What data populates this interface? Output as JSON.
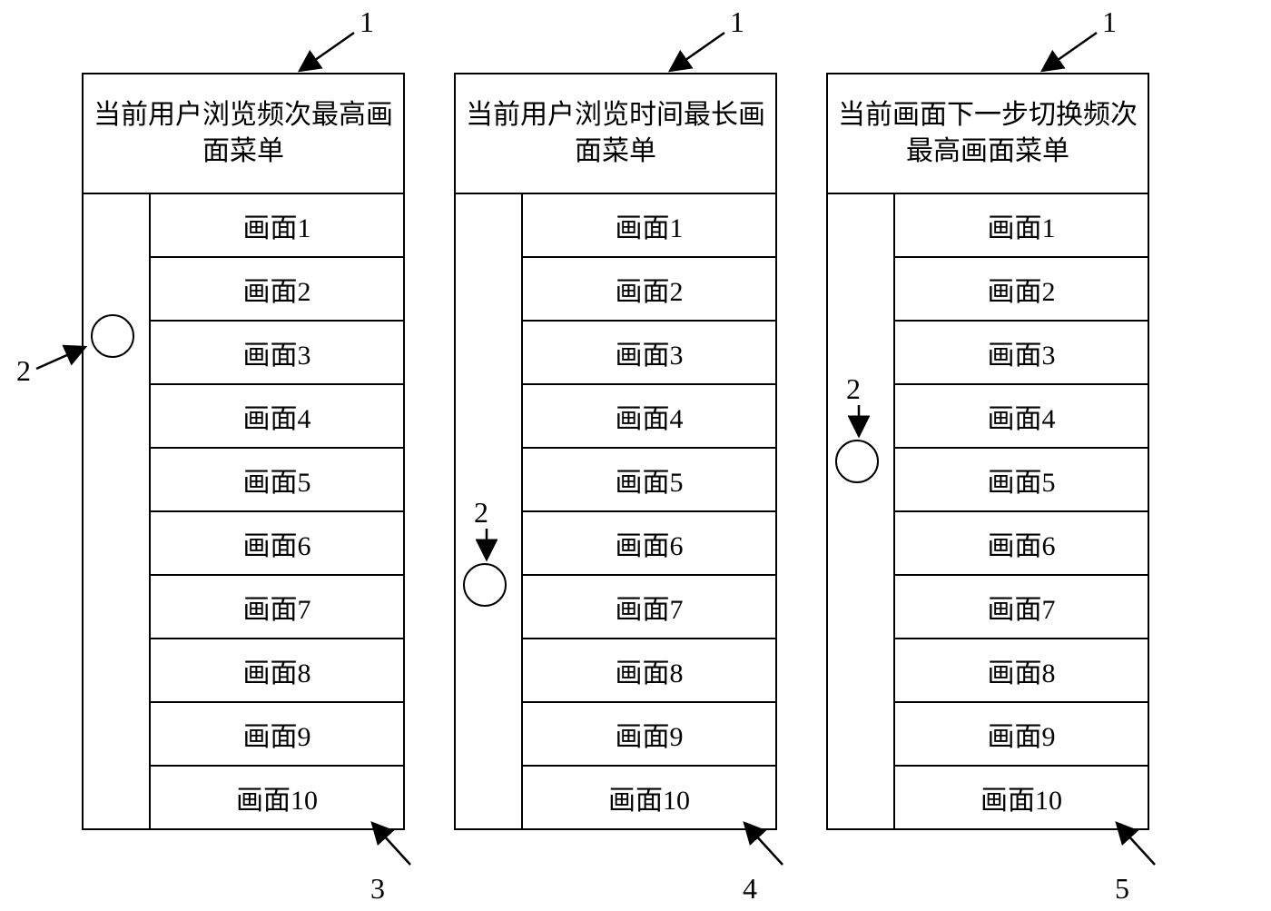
{
  "labels": {
    "top": "1",
    "circle": "2",
    "bottomA": "3",
    "bottomB": "4",
    "bottomC": "5"
  },
  "menus": [
    {
      "title": "当前用户浏览频次最高画面菜单",
      "items": [
        "画面1",
        "画面2",
        "画面3",
        "画面4",
        "画面5",
        "画面6",
        "画面7",
        "画面8",
        "画面9",
        "画面10"
      ]
    },
    {
      "title": "当前用户浏览时间最长画面菜单",
      "items": [
        "画面1",
        "画面2",
        "画面3",
        "画面4",
        "画面5",
        "画面6",
        "画面7",
        "画面8",
        "画面9",
        "画面10"
      ]
    },
    {
      "title": "当前画面下一步切换频次最高画面菜单",
      "items": [
        "画面1",
        "画面2",
        "画面3",
        "画面4",
        "画面5",
        "画面6",
        "画面7",
        "画面8",
        "画面9",
        "画面10"
      ]
    }
  ]
}
